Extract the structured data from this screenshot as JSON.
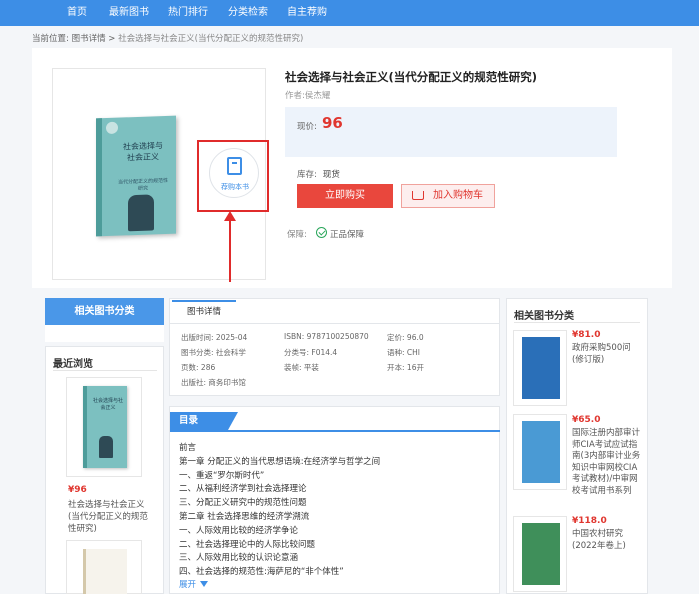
{
  "nav": {
    "items": [
      "首页",
      "最新图书",
      "热门排行",
      "分类检索",
      "自主荐购"
    ]
  },
  "breadcrumb": {
    "prefix": "当前位置:",
    "link": "图书详情",
    "sep": ">",
    "current": "社会选择与社会正义(当代分配正义的规范性研究)"
  },
  "product": {
    "title": "社会选择与社会正义(当代分配正义的规范性研究)",
    "author": "作者:侯杰耀",
    "price_label": "现价:",
    "price": "96",
    "stock_label": "库存:",
    "stock_value": "现货",
    "buy_label": "立即购买",
    "cart_label": "加入购物车",
    "guarantee_label": "保障:",
    "guarantee_value": "正品保障",
    "recommend_label": "荐购本书",
    "cover": {
      "title": "社会选择与社会正义",
      "subtitle": "当代分配正义的规范性研究"
    }
  },
  "left": {
    "category_header": "相关图书分类",
    "recent_title": "最近浏览",
    "recent_price": "¥96",
    "recent_name": "社会选择与社会正义(当代分配正义的规范性研究)"
  },
  "details": {
    "tab": "图书详情",
    "rows": [
      {
        "label": "出版时间:",
        "value": "2025-04"
      },
      {
        "label": "ISBN:",
        "value": "9787100250870"
      },
      {
        "label": "定价:",
        "value": "96.0"
      },
      {
        "label": "图书分类:",
        "value": "社会科学"
      },
      {
        "label": "分类号:",
        "value": "F014.4"
      },
      {
        "label": "语种:",
        "value": "CHI"
      },
      {
        "label": "页数:",
        "value": "286"
      },
      {
        "label": "装帧:",
        "value": "平装"
      },
      {
        "label": "开本:",
        "value": "16开"
      },
      {
        "label": "出版社:",
        "value": "商务印书馆"
      }
    ]
  },
  "toc": {
    "tab": "目录",
    "items": [
      "前言",
      "第一章 分配正义的当代思想语境:在经济学与哲学之间",
      "一、重返“罗尔斯时代”",
      "二、从福利经济学到社会选择理论",
      "三、分配正义研究中的规范性问题",
      "第二章 社会选择思维的经济学溯流",
      "一、人际效用比较的经济学争论",
      "二、社会选择理论中的人际比较问题",
      "三、人际效用比较的认识论意涵",
      "四、社会选择的规范性:海萨尼的“非个体性”"
    ],
    "expand": "展开"
  },
  "right": {
    "title": "相关图书分类",
    "books": [
      {
        "price": "¥81.0",
        "name": "政府采购500问(修订版)",
        "color": "#2a6fb8"
      },
      {
        "price": "¥65.0",
        "name": "国际注册内部审计师CIA考试应试指南(3内部审计业务知识中审网校CIA考试教材)/中审网校考试用书系列",
        "color": "#4a9ad4"
      },
      {
        "price": "¥118.0",
        "name": "中国农村研究(2022年卷上)",
        "color": "#3f8f5a"
      }
    ]
  }
}
